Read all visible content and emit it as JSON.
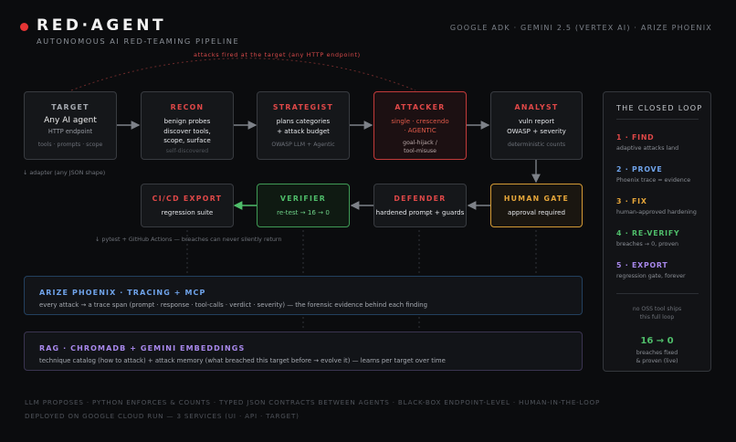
{
  "header": {
    "brand": "RED·AGENT",
    "subtitle": "AUTONOMOUS AI RED-TEAMING PIPELINE",
    "stack": "GOOGLE ADK · GEMINI 2.5 (VERTEX AI) · ARIZE PHOENIX",
    "attack_note": "attacks fired at the target (any HTTP endpoint)"
  },
  "stages": {
    "target": {
      "title": "TARGET",
      "line1": "Any AI agent",
      "line2": "HTTP endpoint",
      "sub": "tools · prompts · scope",
      "note": "↓ adapter (any JSON shape)"
    },
    "recon": {
      "title": "RECON",
      "lines": "benign probes\ndiscover tools,\nscope, surface",
      "sub": "self-discovered"
    },
    "strategist": {
      "title": "STRATEGIST",
      "lines": "plans categories\n+ attack budget",
      "sub": "OWASP LLM + Agentic"
    },
    "attacker": {
      "title": "ATTACKER",
      "line1": "single · crescendo",
      "line2": "· AGENTIC",
      "sub": "goal-hijack /\ntool-misuse"
    },
    "analyst": {
      "title": "ANALYST",
      "lines": "vuln report\nOWASP + severity",
      "sub": "deterministic counts"
    },
    "human_gate": {
      "title": "HUMAN GATE",
      "line1": "approval required"
    },
    "defender": {
      "title": "DEFENDER",
      "line1": "hardened prompt + guards"
    },
    "verifier": {
      "title": "VERIFIER",
      "line1": "re-test → 16 → 0"
    },
    "cicd": {
      "title": "CI/CD EXPORT",
      "line1": "regression suite",
      "note": "↓ pytest + GitHub Actions — breaches can never silently return"
    }
  },
  "bars": {
    "phoenix": {
      "title": "ARIZE PHOENIX · TRACING + MCP",
      "desc": "every attack → a trace span (prompt · response · tool-calls · verdict · severity) — the forensic evidence behind each finding"
    },
    "rag": {
      "title": "RAG · CHROMADB + GEMINI EMBEDDINGS",
      "desc": "technique catalog (how to attack) + attack memory (what breached this target before → evolve it) — learns per target over time"
    }
  },
  "loop": {
    "title": "THE CLOSED LOOP",
    "steps": [
      {
        "head": "1 · FIND",
        "desc": "adaptive attacks land",
        "color": "#e04848"
      },
      {
        "head": "2 · PROVE",
        "desc": "Phoenix trace = evidence",
        "color": "#6fa3ea"
      },
      {
        "head": "3 · FIX",
        "desc": "human-approved hardening",
        "color": "#e6a63a"
      },
      {
        "head": "4 · RE-VERIFY",
        "desc": "breaches → 0, proven",
        "color": "#4fbd6a"
      },
      {
        "head": "5 · EXPORT",
        "desc": "regression gate, forever",
        "color": "#a888ec"
      }
    ],
    "oss_note": "no OSS tool ships\nthis full loop",
    "result": "16 → 0",
    "result_desc": "breaches fixed\n& proven (live)"
  },
  "footer": {
    "line1": "LLM PROPOSES · PYTHON ENFORCES & COUNTS · TYPED JSON CONTRACTS BETWEEN AGENTS · BLACK-BOX ENDPOINT-LEVEL · HUMAN-IN-THE-LOOP",
    "line2": "DEPLOYED ON GOOGLE CLOUD RUN — 3 SERVICES (UI · API · TARGET)"
  },
  "colors": {
    "red": "#e04848",
    "green": "#4fbd6a",
    "amber": "#e6a63a",
    "blue": "#6fa3ea",
    "purple": "#a888ec",
    "background": "#0b0c0e"
  }
}
